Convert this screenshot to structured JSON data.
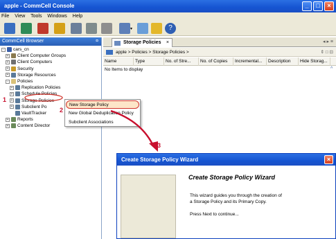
{
  "window": {
    "title": "apple - CommCell Console"
  },
  "menubar": [
    "File",
    "View",
    "Tools",
    "Windows",
    "Help"
  ],
  "left_pane": {
    "header": "CommCell Browser",
    "tree": [
      {
        "label": "cars_cn",
        "depth": 0,
        "exp": "-",
        "color": "#3a5fa8"
      },
      {
        "label": "Client Computer Groups",
        "depth": 1,
        "exp": "+",
        "color": "#8a7a50"
      },
      {
        "label": "Client Computers",
        "depth": 1,
        "exp": "+",
        "color": "#707070"
      },
      {
        "label": "Security",
        "depth": 1,
        "exp": "+",
        "color": "#c79a2a"
      },
      {
        "label": "Storage Resources",
        "depth": 1,
        "exp": "+",
        "color": "#5a7a9a"
      },
      {
        "label": "Policies",
        "depth": 1,
        "exp": "-",
        "color": "#d9c27a"
      },
      {
        "label": "Replication Policies",
        "depth": 2,
        "exp": "+",
        "color": "#5a7a9a"
      },
      {
        "label": "Schedule Policies",
        "depth": 2,
        "exp": "+",
        "color": "#5a7a9a"
      },
      {
        "label": "Storage Policies",
        "depth": 2,
        "exp": "+",
        "color": "#5a7a9a"
      },
      {
        "label": "Subclient Po",
        "depth": 2,
        "exp": "+",
        "color": "#5a7a9a"
      },
      {
        "label": "VaultTracker",
        "depth": 2,
        "exp": "",
        "color": "#5a7a9a"
      },
      {
        "label": "Reports",
        "depth": 1,
        "exp": "+",
        "color": "#6a8a5a"
      },
      {
        "label": "Content Director",
        "depth": 1,
        "exp": "+",
        "color": "#6a8a5a"
      }
    ]
  },
  "tab": {
    "label": "Storage Policies"
  },
  "breadcrumb": {
    "text": "apple  >  Policies  >  Storage Policies  >"
  },
  "columns": [
    "Name",
    "Type",
    "No. of Stre...",
    "No. of Copies",
    "Incremental...",
    "Description",
    "Hide Storag..."
  ],
  "list_empty": "No Items to display",
  "context_menu": [
    "New Storage Policy",
    "New Global Deduplication Policy",
    "Subclient Associations"
  ],
  "markers": [
    "1",
    "2",
    "3"
  ],
  "wizard": {
    "title": "Create Storage Policy Wizard",
    "heading": "Create Storage Policy Wizard",
    "line1": "This wizard guides you through the creation of",
    "line2": "a Storage Policy and its Primary Copy.",
    "line3": "Press Next to continue..."
  },
  "colors": {
    "accent": "#1554d1",
    "annotation": "#c8102e"
  }
}
